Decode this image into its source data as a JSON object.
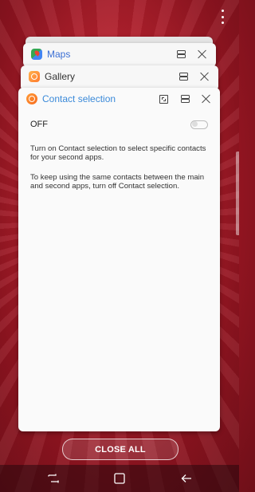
{
  "top_menu": {
    "icon": "more-vertical-icon"
  },
  "cards": {
    "maps": {
      "title": "Maps",
      "title_color": "#3b6fd4"
    },
    "gallery": {
      "title": "Gallery",
      "title_color": "#333333"
    },
    "contact": {
      "title": "Contact selection",
      "title_color": "#3b8ad9",
      "setting_label": "OFF",
      "toggle_state": "off",
      "description_1": "Turn on Contact selection to select specific contacts for your second apps.",
      "description_2": "To keep using the same contacts between the main and second apps, turn off Contact selection."
    }
  },
  "bottom": {
    "close_all_label": "CLOSE ALL"
  },
  "navbar": {
    "buttons": [
      "recents-icon",
      "home-icon",
      "back-icon"
    ]
  }
}
